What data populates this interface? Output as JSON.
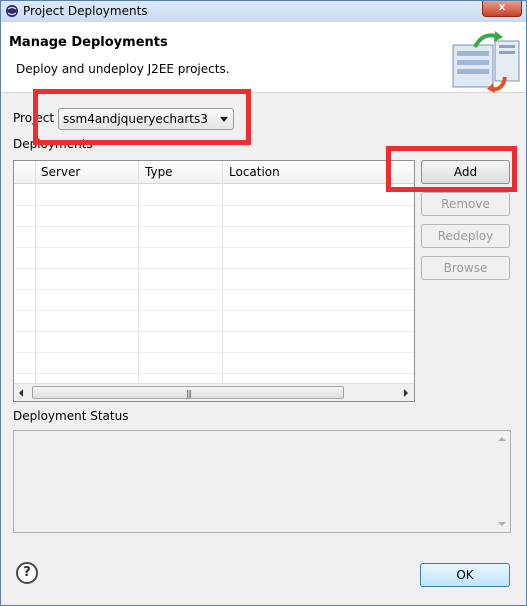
{
  "window": {
    "title": "Project Deployments",
    "close_label": "x"
  },
  "header": {
    "title": "Manage Deployments",
    "description": "Deploy and undeploy J2EE projects."
  },
  "project": {
    "label": "Project",
    "selected": "ssm4andjqueryecharts3"
  },
  "deployments": {
    "label": "Deployments",
    "columns": [
      "Server",
      "Type",
      "Location"
    ],
    "rows": [],
    "scroll_grip": "|||"
  },
  "buttons": {
    "add": "Add",
    "remove": "Remove",
    "redeploy": "Redeploy",
    "browse": "Browse"
  },
  "status": {
    "label": "Deployment Status",
    "text": ""
  },
  "footer": {
    "help": "?",
    "ok": "OK"
  },
  "colors": {
    "highlight": "#ee2e2e",
    "title_bar": "#c9dcf0"
  }
}
